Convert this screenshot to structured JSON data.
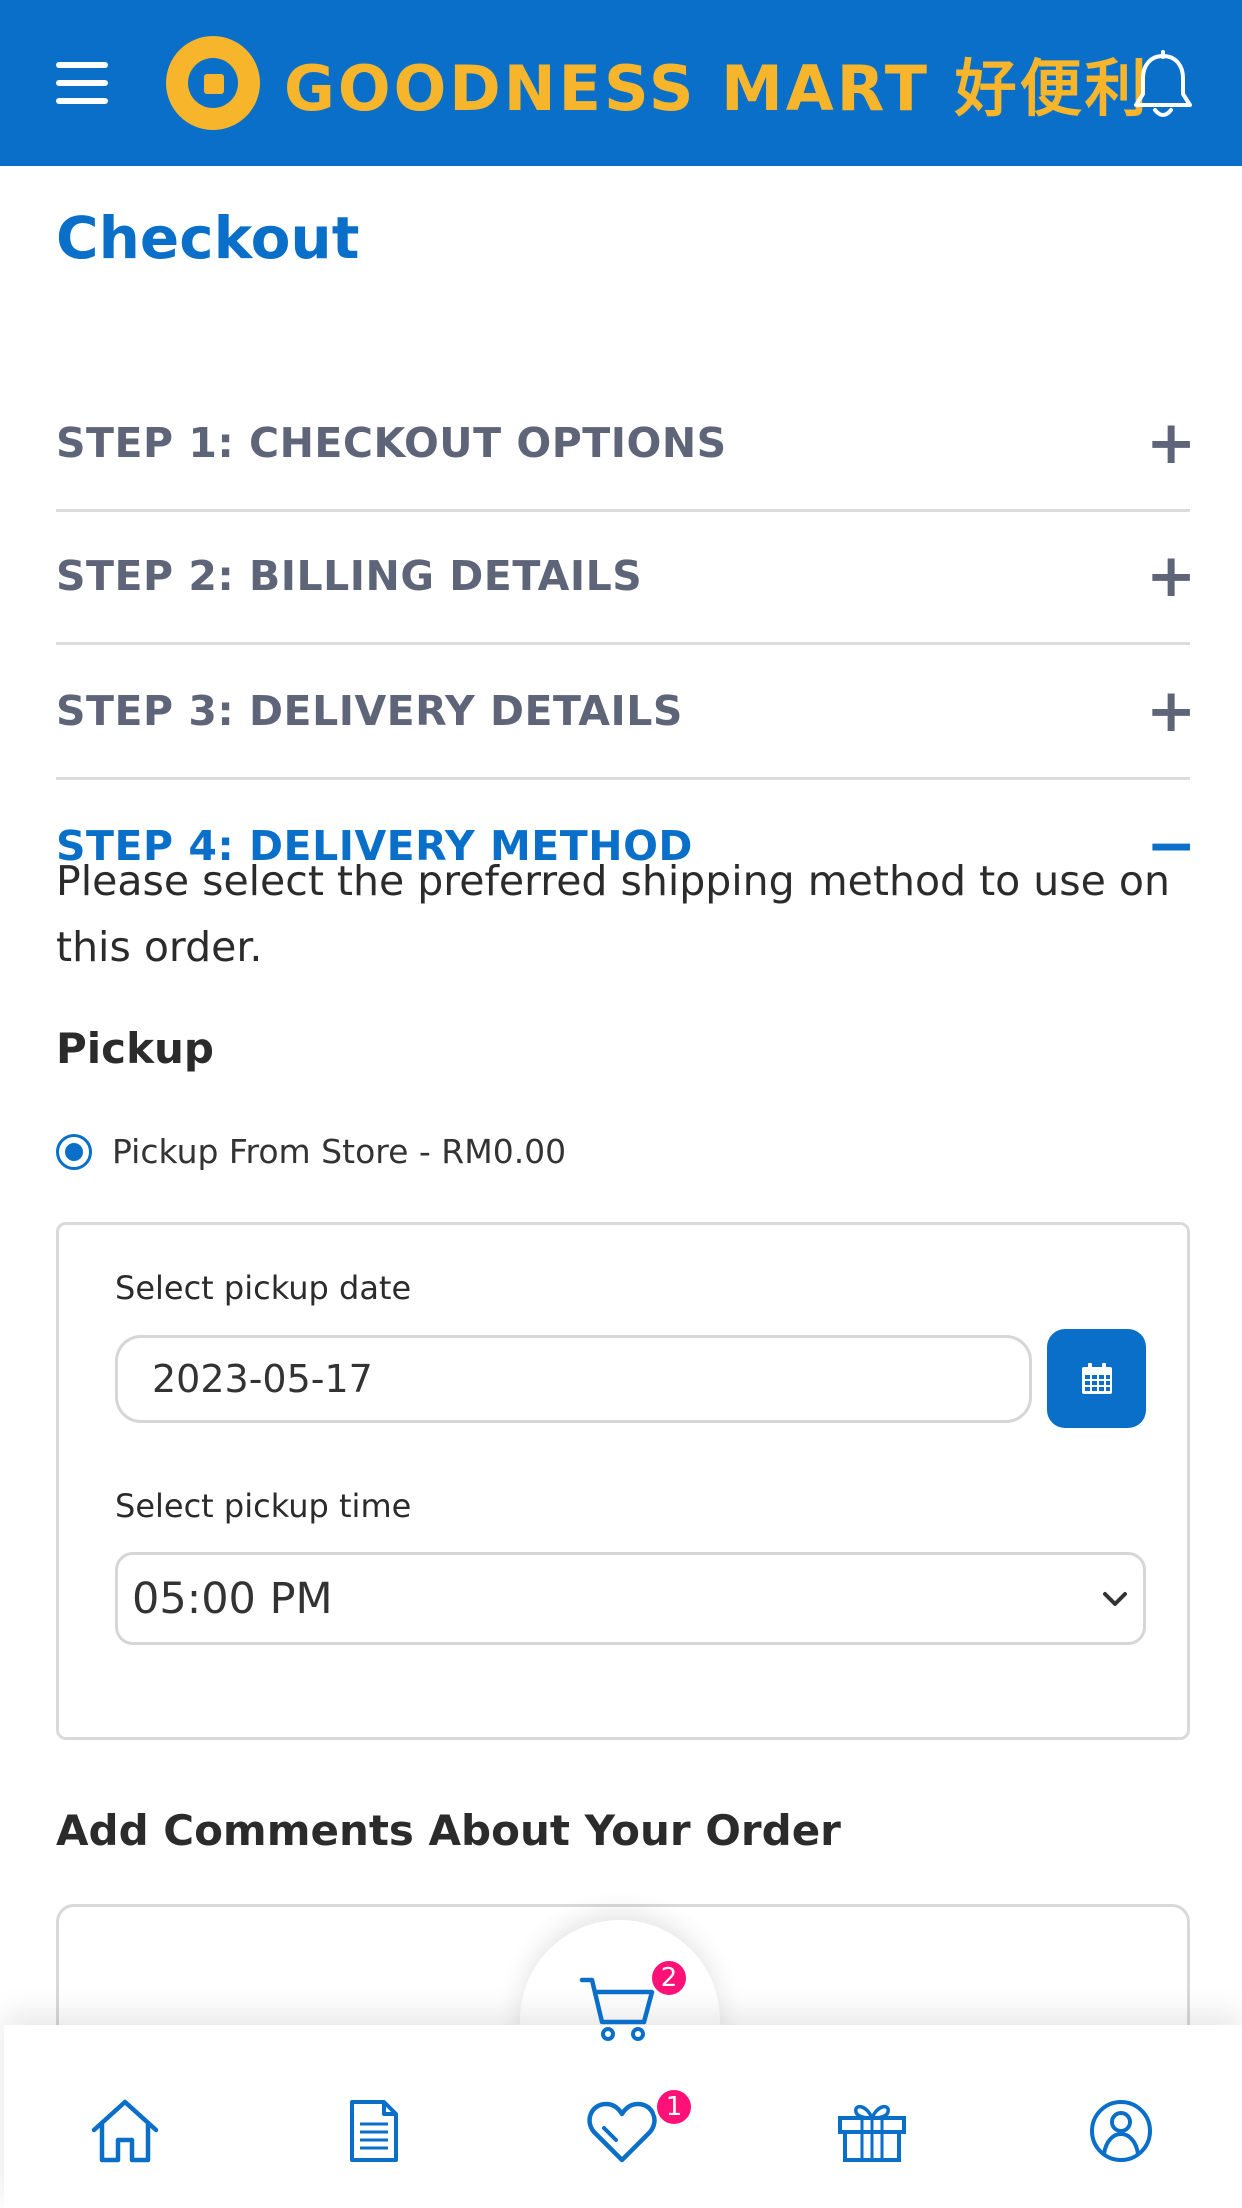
{
  "header": {
    "brand": "GOODNESS MART 好便利",
    "brand_color": "#f7b52b",
    "bar_color": "#0a6fc9",
    "menu_icon": "hamburger-menu-icon",
    "notification_icon": "bell-icon"
  },
  "page": {
    "title": "Checkout"
  },
  "steps": [
    {
      "label": "STEP 1: CHECKOUT OPTIONS",
      "toggle": "+"
    },
    {
      "label": "STEP 2: BILLING DETAILS",
      "toggle": "+"
    },
    {
      "label": "STEP 3: DELIVERY DETAILS",
      "toggle": "+"
    },
    {
      "label": "STEP 4: DELIVERY METHOD",
      "toggle": "−"
    }
  ],
  "delivery_method": {
    "description": "Please select the preferred shipping method to use on this order.",
    "pickup_heading": "Pickup",
    "pickup_option": "Pickup From Store - RM0.00",
    "date_label": "Select pickup date",
    "date_value": "2023-05-17",
    "time_label": "Select pickup time",
    "time_value": "05:00 PM"
  },
  "comments": {
    "heading": "Add Comments About Your Order"
  },
  "bottom_nav": {
    "cart_badge": "2",
    "wishlist_badge": "1",
    "icons": [
      "home-icon",
      "orders-icon",
      "cart-icon",
      "wishlist-icon",
      "rewards-icon",
      "account-icon"
    ],
    "icon_color": "#0a6fc9",
    "badge_color": "#ff1178"
  }
}
